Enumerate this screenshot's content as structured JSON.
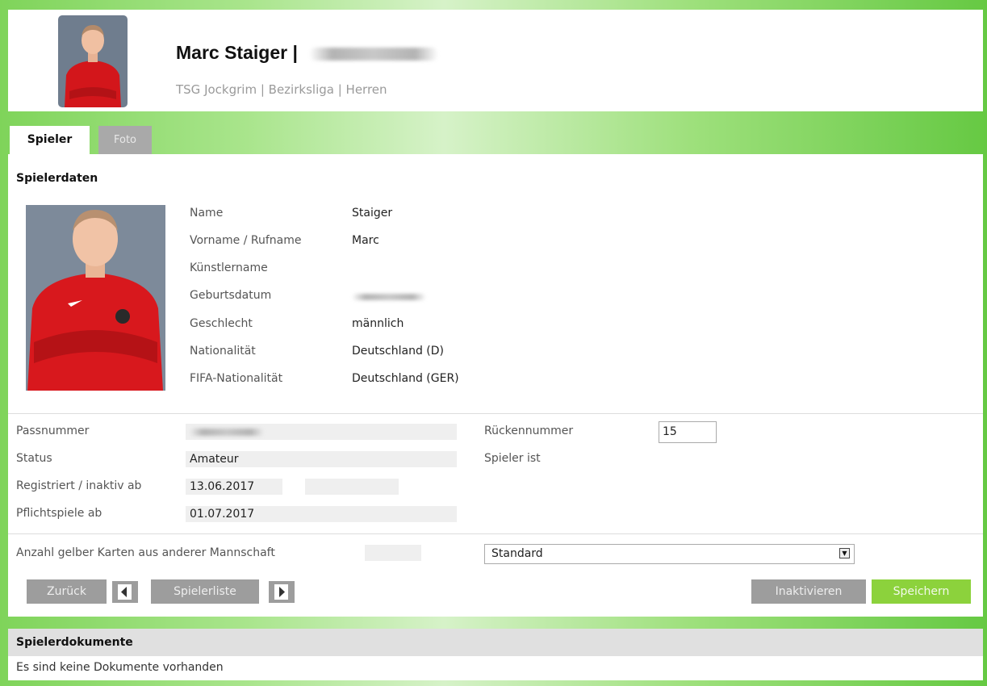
{
  "header": {
    "name": "Marc Staiger |",
    "subtitle": "TSG Jockgrim | Bezirksliga | Herren"
  },
  "tabs": [
    {
      "label": "Spieler",
      "active": true
    },
    {
      "label": "Foto",
      "active": false
    }
  ],
  "spielerdaten": {
    "title": "Spielerdaten",
    "fields": [
      {
        "label": "Name",
        "value": "Staiger"
      },
      {
        "label": "Vorname / Rufname",
        "value": "Marc"
      },
      {
        "label": "Künstlername",
        "value": ""
      },
      {
        "label": "Geburtsdatum",
        "value": ""
      },
      {
        "label": "Geschlecht",
        "value": "männlich"
      },
      {
        "label": "Nationalität",
        "value": "Deutschland (D)"
      },
      {
        "label": "FIFA-Nationalität",
        "value": "Deutschland (GER)"
      }
    ]
  },
  "registration": {
    "passnummer_label": "Passnummer",
    "status_label": "Status",
    "status_value": "Amateur",
    "registriert_label": "Registriert / inaktiv ab",
    "registriert_value": "13.06.2017",
    "inaktiv_value": "",
    "pflichtspiele_label": "Pflichtspiele ab",
    "pflichtspiele_value": "01.07.2017",
    "rueckennummer_label": "Rückennummer",
    "rueckennummer_value": "15",
    "spieler_ist_label": "Spieler ist"
  },
  "cards": {
    "label": "Anzahl gelber Karten aus anderer Mannschaft",
    "value": "",
    "select_value": "Standard"
  },
  "buttons": {
    "back": "Zurück",
    "list": "Spielerliste",
    "deactivate": "Inaktivieren",
    "save": "Speichern"
  },
  "documents": {
    "title": "Spielerdokumente",
    "empty_text": "Es sind keine Dokumente vorhanden"
  },
  "colors": {
    "accent_green": "#8cd23c",
    "button_gray": "#9d9d9d",
    "background_green": "#7fd45a"
  },
  "icons": {
    "prev": "arrow-left-icon",
    "next": "arrow-right-icon",
    "dropdown": "chevron-down-icon"
  }
}
